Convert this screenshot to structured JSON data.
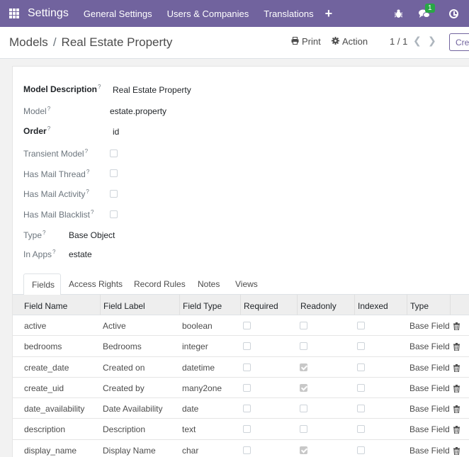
{
  "navbar": {
    "brand": "Settings",
    "menu": [
      "General Settings",
      "Users & Companies",
      "Translations"
    ],
    "plus": "+",
    "chat_badge": "1",
    "icons": [
      "apps-grid-icon",
      "bug-icon",
      "chat-icon",
      "clock-icon"
    ]
  },
  "control": {
    "breadcrumb_parent": "Models",
    "breadcrumb_sep": "/",
    "breadcrumb_current": "Real Estate Property",
    "print_label": "Print",
    "action_label": "Action",
    "pager": "1 / 1",
    "create_label": "Cre"
  },
  "form": {
    "model_description_label": "Model Description",
    "model_description_value": "Real Estate Property",
    "model_label": "Model",
    "model_value": "estate.property",
    "order_label": "Order",
    "order_value": "id",
    "transient_label": "Transient Model",
    "mail_thread_label": "Has Mail Thread",
    "mail_activity_label": "Has Mail Activity",
    "mail_blacklist_label": "Has Mail Blacklist",
    "type_label": "Type",
    "type_value": "Base Object",
    "in_apps_label": "In Apps",
    "in_apps_value": "estate",
    "help_mark": "?"
  },
  "tabs": [
    "Fields",
    "Access Rights",
    "Record Rules",
    "Notes",
    "Views"
  ],
  "table": {
    "headers": [
      "Field Name",
      "Field Label",
      "Field Type",
      "Required",
      "Readonly",
      "Indexed",
      "Type"
    ],
    "rows": [
      {
        "name": "active",
        "label": "Active",
        "ftype": "boolean",
        "required": false,
        "readonly": false,
        "indexed": false,
        "type": "Base Field"
      },
      {
        "name": "bedrooms",
        "label": "Bedrooms",
        "ftype": "integer",
        "required": false,
        "readonly": false,
        "indexed": false,
        "type": "Base Field"
      },
      {
        "name": "create_date",
        "label": "Created on",
        "ftype": "datetime",
        "required": false,
        "readonly": true,
        "indexed": false,
        "type": "Base Field"
      },
      {
        "name": "create_uid",
        "label": "Created by",
        "ftype": "many2one",
        "required": false,
        "readonly": true,
        "indexed": false,
        "type": "Base Field"
      },
      {
        "name": "date_availability",
        "label": "Date Availability",
        "ftype": "date",
        "required": false,
        "readonly": false,
        "indexed": false,
        "type": "Base Field"
      },
      {
        "name": "description",
        "label": "Description",
        "ftype": "text",
        "required": false,
        "readonly": false,
        "indexed": false,
        "type": "Base Field"
      },
      {
        "name": "display_name",
        "label": "Display Name",
        "ftype": "char",
        "required": false,
        "readonly": true,
        "indexed": false,
        "type": "Base Field"
      }
    ]
  }
}
